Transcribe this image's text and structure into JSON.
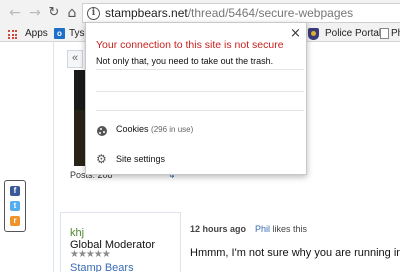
{
  "toolbar": {
    "back_icon": "arrow-left-icon",
    "forward_icon": "arrow-right-icon",
    "reload_icon": "reload-icon",
    "home_icon": "home-icon",
    "url_host": "stampbears.net",
    "url_path": "/thread/5464/secure-webpages"
  },
  "bookmarks": {
    "apps_label": "Apps",
    "item_1_label": "Tys",
    "item_2_label": "Police Portal",
    "item_3_label": "Ph"
  },
  "popup": {
    "title": "Your connection to this site is not secure",
    "message": "Not only that, you need to take out the trash.",
    "close_glyph": "×",
    "cookies_label": "Cookies",
    "cookies_count": "(296 in use)",
    "site_settings_label": "Site settings",
    "warning_color": "#c5221f"
  },
  "page": {
    "prev_glyph": "«",
    "posts_label": "Posts: 208",
    "post_meta_glyph": "↳",
    "username": "khj",
    "user_title": "Global Moderator",
    "stars": "★★★★★",
    "group_name": "Stamp Bears",
    "time_ago": "12 hours ago",
    "liker": "Phil",
    "likes_suffix": "likes this",
    "post_text": "Hmmm, I'm not sure why you are running int"
  },
  "social": {
    "facebook": "f",
    "twitter": "t",
    "rss": "r"
  }
}
